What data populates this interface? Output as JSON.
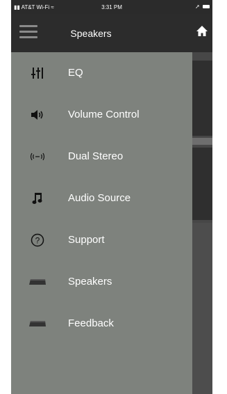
{
  "status_bar": {
    "carrier": "AT&T Wi-Fi",
    "time": "3:31 PM"
  },
  "nav": {
    "title": "Speakers",
    "menu_icon": "hamburger-icon",
    "home_icon": "home-icon"
  },
  "menu": {
    "items": [
      {
        "label": "EQ",
        "icon": "equalizer-icon"
      },
      {
        "label": "Volume Control",
        "icon": "speaker-volume-icon"
      },
      {
        "label": "Dual Stereo",
        "icon": "dual-stereo-icon"
      },
      {
        "label": "Audio Source",
        "icon": "music-note-icon"
      },
      {
        "label": "Support",
        "icon": "question-circle-icon"
      },
      {
        "label": "Speakers",
        "icon": "speaker-device-icon"
      },
      {
        "label": "Feedback",
        "icon": "speaker-device-icon"
      }
    ]
  },
  "colors": {
    "drawer_bg": "#7e827d",
    "nav_bg": "#2c2c2c",
    "icon_color": "#111111",
    "text_color": "#ffffff"
  }
}
